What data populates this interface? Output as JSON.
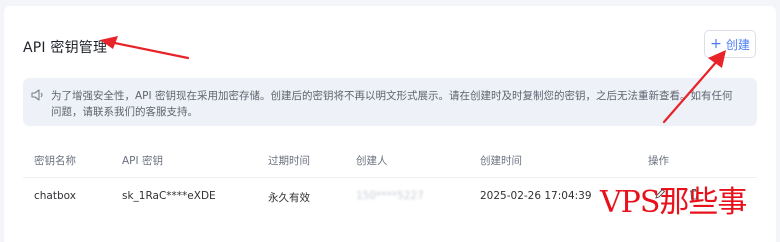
{
  "page": {
    "title": "API 密钥管理",
    "create_label": "创建"
  },
  "notice": {
    "icon": "speaker-icon",
    "text": "为了增强安全性，API 密钥现在采用加密存储。创建后的密钥将不再以明文形式展示。请在创建时及时复制您的密钥，之后无法重新查看。如有任何问题，请联系我们的客服支持。"
  },
  "table": {
    "headers": [
      "密钥名称",
      "API 密钥",
      "过期时间",
      "创建人",
      "创建时间",
      "操作"
    ],
    "rows": [
      {
        "name": "chatbox",
        "key": "sk_1RaC****eXDE",
        "expires": "永久有效",
        "creator": "150****5227",
        "created_at": "2025-02-26 17:04:39"
      }
    ]
  },
  "watermark": "VPS那些事",
  "colors": {
    "accent": "#4a7cf7",
    "arrow": "#e8232a",
    "notice_bg": "#eef1f7"
  }
}
